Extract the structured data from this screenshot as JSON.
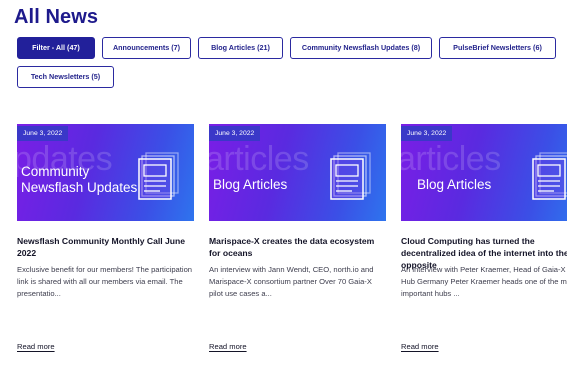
{
  "heading": "All News",
  "filters": [
    {
      "label": "Filter - All  (47)",
      "active": true
    },
    {
      "label": "Announcements  (7)",
      "active": false
    },
    {
      "label": "Blog Articles  (21)",
      "active": false
    },
    {
      "label": "Community Newsflash Updates  (8)",
      "active": false
    },
    {
      "label": "PulseBrief Newsletters  (6)",
      "active": false
    },
    {
      "label": "Tech Newsletters  (5)",
      "active": false
    }
  ],
  "cards": [
    {
      "date": "June 3, 2022",
      "ghost_text": "pdates",
      "category": "Community\nNewsflash Updates",
      "title": "Newsflash Community Monthly Call June 2022",
      "excerpt": "Exclusive benefit for our members! The participation link is shared with all our members via email. The presentatio...",
      "read_more": "Read more"
    },
    {
      "date": "June 3, 2022",
      "ghost_text": "articles",
      "category": "Blog Articles",
      "title": "Marispace-X creates the data ecosystem for oceans",
      "excerpt": "An interview with Jann Wendt, CEO, north.io and Marispace-X consortium partner Over 70 Gaia-X pilot use cases a...",
      "read_more": "Read more"
    },
    {
      "date": "June 3, 2022",
      "ghost_text": "articles",
      "category": "Blog Articles",
      "title": "Cloud Computing has turned the decentralized idea of the internet into the opposite",
      "excerpt": "An interview with Peter Kraemer, Head of Gaia-X Hub Germany Peter Kraemer heads one of the most important hubs ...",
      "read_more": "Read more"
    }
  ]
}
